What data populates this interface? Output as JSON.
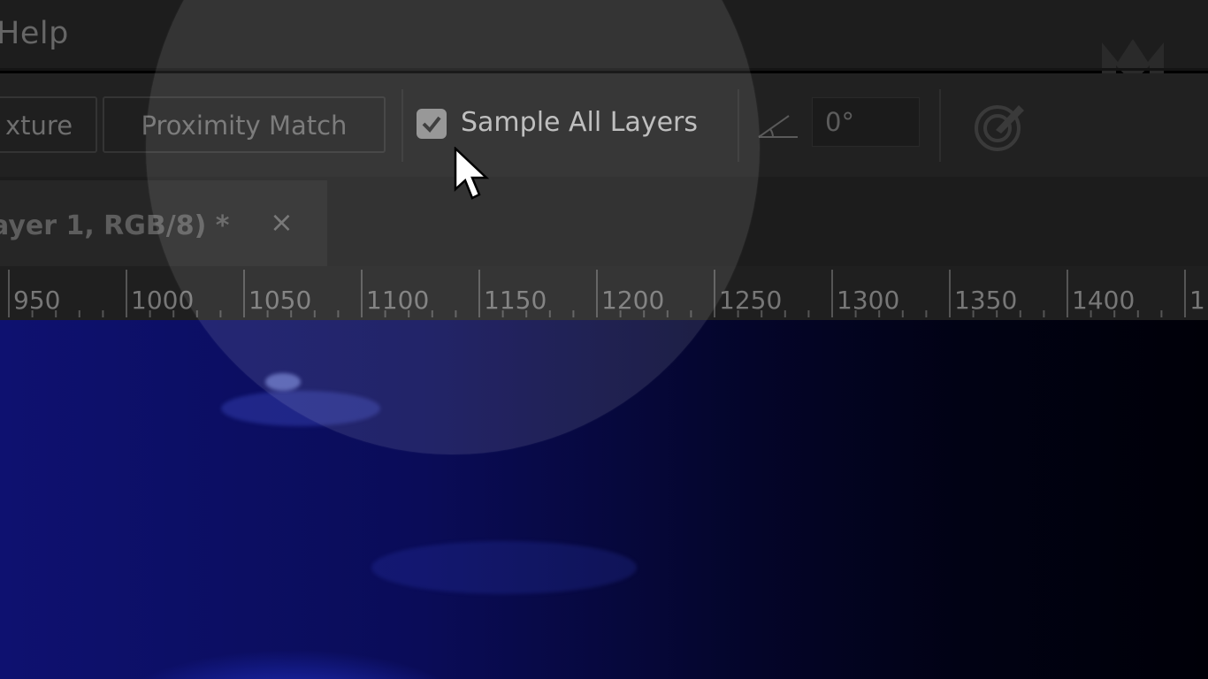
{
  "menubar": {
    "help_label": "Help"
  },
  "options": {
    "texture_label": "xture",
    "proximity_label": "Proximity Match",
    "sample_all_layers_label": "Sample All Layers",
    "sample_all_layers_checked": true,
    "angle_value": "0°",
    "icons": [
      "checkmark-icon",
      "angle-icon",
      "pressure-icon"
    ]
  },
  "tab": {
    "title": "ayer 1, RGB/8) *",
    "close_glyph": "×"
  },
  "ruler": {
    "labels": [
      "950",
      "1000",
      "1050",
      "1100",
      "1150",
      "1200",
      "1250",
      "1300",
      "1350",
      "1400",
      "1"
    ]
  },
  "colors": {
    "canvas_blue": "#1a22c8",
    "ui_dark": "#1d1d1d"
  }
}
